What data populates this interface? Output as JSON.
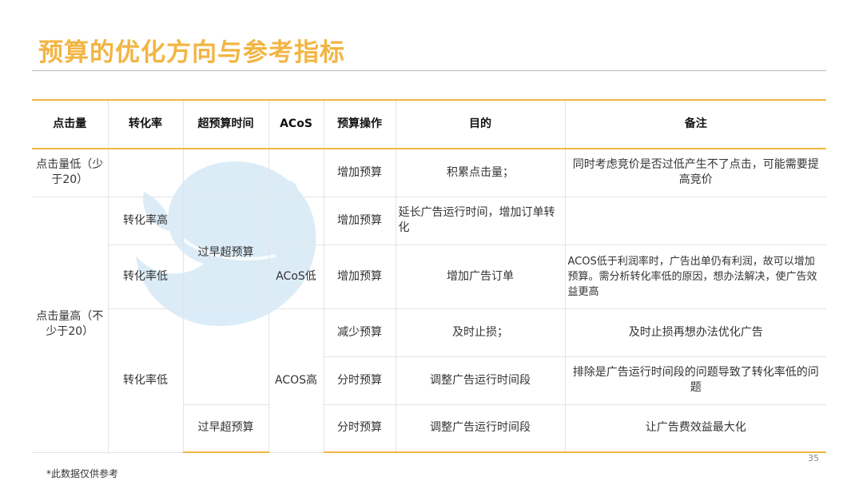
{
  "title": "预算的优化方向与参考指标",
  "colors": {
    "accent": "#F2B544",
    "watermark": "#cfe6f5"
  },
  "headers": [
    "点击量",
    "转化率",
    "超预算时间",
    "ACoS",
    "预算操作",
    "目的",
    "备注"
  ],
  "rows": {
    "r1": {
      "clicks": "点击量低（少于20）",
      "action": "增加预算",
      "purpose": "积累点击量；",
      "note": "同时考虑竞价是否过低产生不了点击，可能需要提高竞价"
    },
    "r2": {
      "conversion": "转化率高",
      "over_budget": "过早超预算",
      "action": "增加预算",
      "purpose": "延长广告运行时间，增加订单转化",
      "note": ""
    },
    "r3": {
      "conversion": "转化率低",
      "acos": "ACoS低",
      "action": "增加预算",
      "purpose": "增加广告订单",
      "note": "ACOS低于利润率时，广告出单仍有利润，故可以增加预算。需分析转化率低的原因，想办法解决，使广告效益更高"
    },
    "r4": {
      "clicks": "点击量高（不少于20）",
      "conversion": "转化率低",
      "acos": "ACOS高",
      "action": "减少预算",
      "purpose": "及时止损；",
      "note": "及时止损再想办法优化广告"
    },
    "r5": {
      "action": "分时预算",
      "purpose": "调整广告运行时间段",
      "note": "排除是广告运行时间段的问题导致了转化率低的问题"
    },
    "r6": {
      "over_budget": "过早超预算",
      "action": "分时预算",
      "purpose": "调整广告运行时间段",
      "note": "让广告费效益最大化"
    }
  },
  "page_number": "35",
  "footnote": "*此数据仅供参考"
}
